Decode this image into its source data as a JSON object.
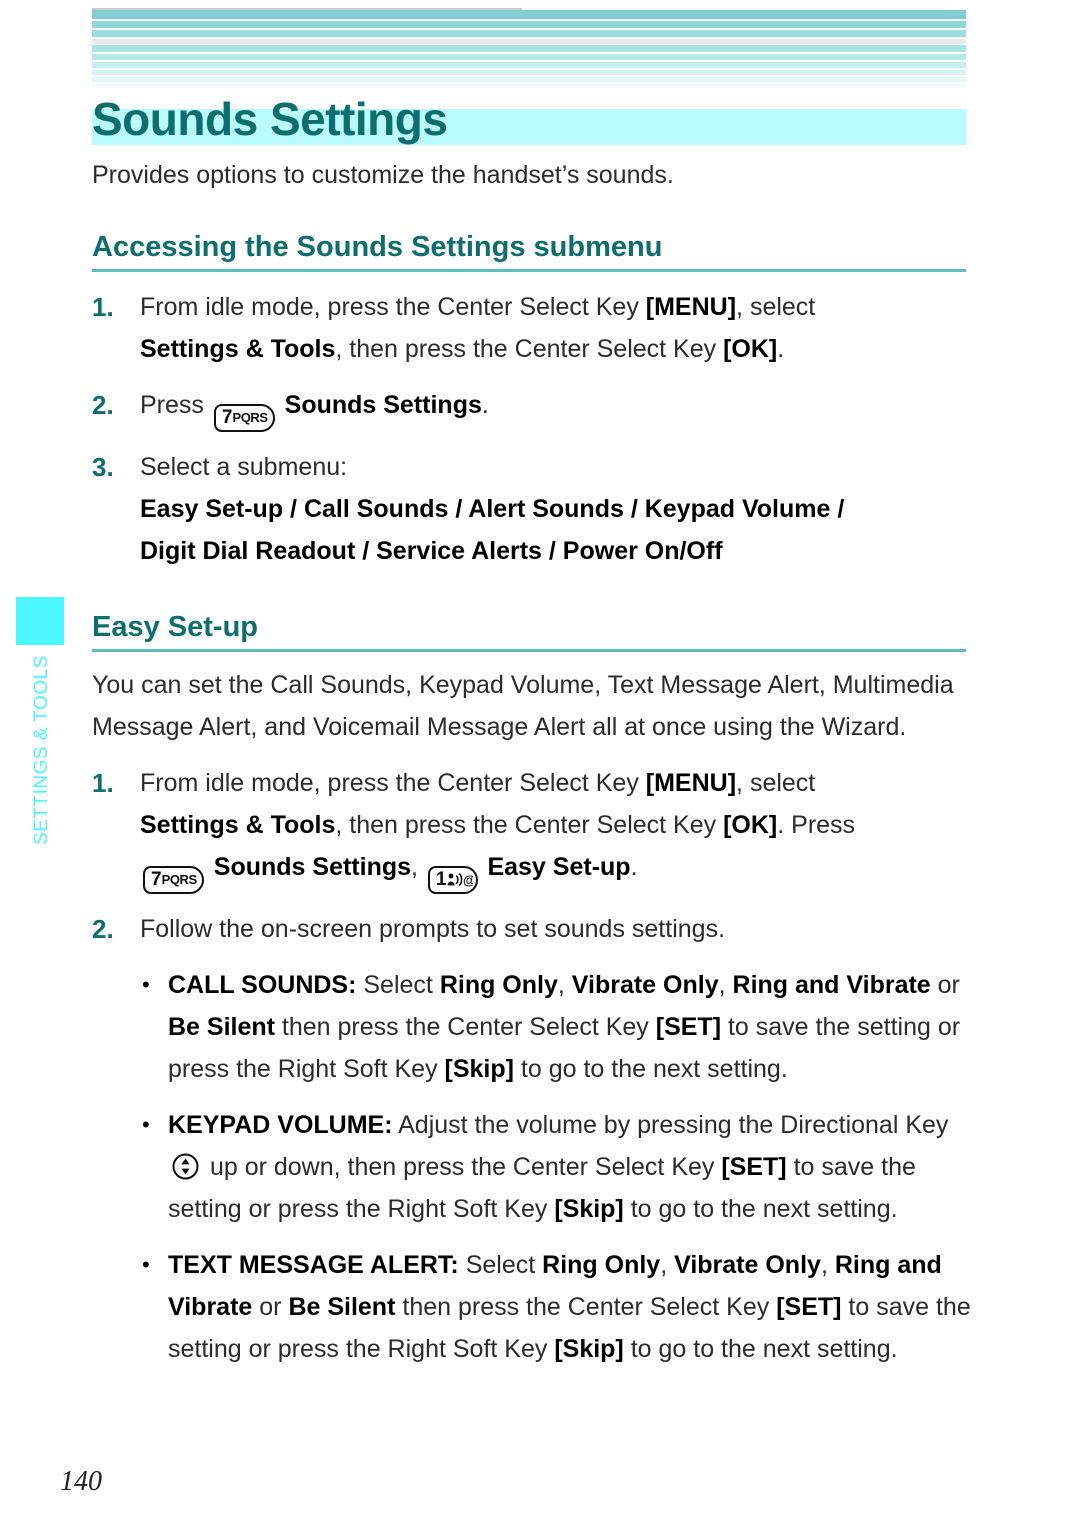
{
  "page": {
    "number": "140",
    "side_tab_label": "SETTINGS & TOOLS",
    "accent_teal": "#0e6e6e",
    "accent_cyan": "#4df7ff",
    "title_highlight": "#b9fbff"
  },
  "title": "Sounds Settings",
  "intro": "Provides options to customize the handset’s sounds.",
  "sections": [
    {
      "heading": "Accessing the Sounds Settings submenu",
      "steps": [
        {
          "num": "1.",
          "line1_a": "From idle mode, press the Center Select Key ",
          "line1_b": "[MENU]",
          "line1_c": ", select",
          "line2_a": "Settings & Tools",
          "line2_b": ", then press the Center Select Key ",
          "line2_c": "[OK]",
          "line2_d": "."
        },
        {
          "num": "2.",
          "press_label": "Press",
          "key7_digit": "7",
          "key7_letters": "PQRS",
          "target": "Sounds Settings",
          "period": "."
        },
        {
          "num": "3.",
          "text": "Select a submenu:"
        }
      ],
      "submenu_line1": "Easy Set-up / Call Sounds / Alert Sounds / Keypad Volume /",
      "submenu_line2": "Digit Dial Readout / Service Alerts / Power On/Off"
    },
    {
      "heading": "Easy Set-up",
      "body": "You can set the Call Sounds, Keypad Volume, Text Message Alert, Multimedia Message Alert, and Voicemail Message Alert all at once using the Wizard.",
      "steps": [
        {
          "num": "1.",
          "line1_a": "From idle mode, press the Center Select Key ",
          "line1_b": "[MENU]",
          "line1_c": ", select",
          "line2_a": "Settings & Tools",
          "line2_b": ", then press the Center Select Key ",
          "line2_c": "[OK]",
          "line2_d": ". Press",
          "key7_digit": "7",
          "key7_letters": "PQRS",
          "target1": "Sounds Settings",
          "comma": ",",
          "key1_digit": "1",
          "target2": "Easy Set-up",
          "period": "."
        },
        {
          "num": "2.",
          "text": "Follow the on-screen prompts to set sounds settings."
        }
      ],
      "bullets": [
        {
          "caption": "CALL SOUNDS:",
          "t1": " Select ",
          "o1": "Ring Only",
          "t2": ", ",
          "o2": "Vibrate Only",
          "t3": ", ",
          "o3": "Ring and Vibrate",
          "t4": " or ",
          "o4": "Be Silent",
          "t5": " then press the Center Select Key ",
          "k1": "[SET]",
          "t6": " to save the setting or press the Right Soft Key ",
          "k2": "[Skip]",
          "t7": " to go to the next setting."
        },
        {
          "caption": "KEYPAD VOLUME:",
          "t1": " Adjust the volume by pressing the Directional Key ",
          "t2": " up or down, then press the Center Select Key ",
          "k1": "[SET]",
          "t3": " to save the setting or press the Right Soft Key ",
          "k2": "[Skip]",
          "t4": " to go to the next setting."
        },
        {
          "caption": "TEXT MESSAGE ALERT:",
          "t1": " Select ",
          "o1": "Ring Only",
          "t2": ", ",
          "o2": "Vibrate Only",
          "t3": ", ",
          "o3": "Ring and Vibrate",
          "t4": " or ",
          "o4": "Be Silent",
          "t5": " then press the Center Select Key ",
          "k1": "[SET]",
          "t6": " to save the setting or press the Right Soft Key ",
          "k2": "[Skip]",
          "t7": " to go to the next setting."
        }
      ]
    }
  ],
  "icons": {
    "key7": "key-7-pqrs-icon",
    "key1": "key-1-voicemail-icon",
    "directional": "directional-key-icon",
    "bullet": "•"
  }
}
